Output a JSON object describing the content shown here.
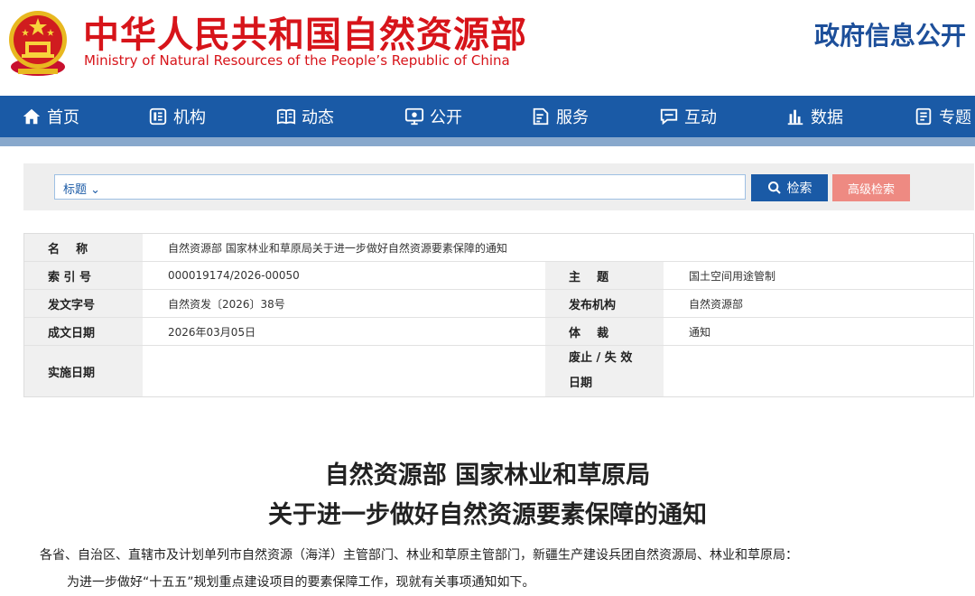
{
  "header": {
    "title_cn": "中华人民共和国自然资源部",
    "title_en": "Ministry of Natural Resources of the People’s Republic of China",
    "gov_open": "政府信息公开"
  },
  "nav": {
    "items": [
      {
        "label": "首页",
        "icon": "home-icon"
      },
      {
        "label": "机构",
        "icon": "org-icon"
      },
      {
        "label": "动态",
        "icon": "book-icon"
      },
      {
        "label": "公开",
        "icon": "monitor-icon"
      },
      {
        "label": "服务",
        "icon": "document-edit-icon"
      },
      {
        "label": "互动",
        "icon": "chat-icon"
      },
      {
        "label": "数据",
        "icon": "bar-chart-icon"
      },
      {
        "label": "专题",
        "icon": "file-icon"
      }
    ]
  },
  "search": {
    "select_label": "标题",
    "placeholder": "",
    "search_label": "检索",
    "advanced_label": "高级检索"
  },
  "info": {
    "name_label": "名    称",
    "name_value": "自然资源部 国家林业和草原局关于进一步做好自然资源要素保障的通知",
    "index_label": "索 引 号",
    "index_value": "000019174/2026-00050",
    "topic_label": "主    题",
    "topic_value": "国土空间用途管制",
    "docno_label": "发文字号",
    "docno_value": "自然资发〔2026〕38号",
    "publisher_label": "发布机构",
    "publisher_value": "自然资源部",
    "date_label": "成文日期",
    "date_value": "2026年03月05日",
    "genre_label": "体    裁",
    "genre_value": "通知",
    "effective_label": "实施日期",
    "effective_value": "",
    "expire_label_1": "废止 / 失 效",
    "expire_label_2": "日期",
    "expire_value": ""
  },
  "document": {
    "title_line1": "自然资源部 国家林业和草原局",
    "title_line2": "关于进一步做好自然资源要素保障的通知",
    "para1": "各省、自治区、直辖市及计划单列市自然资源（海洋）主管部门、林业和草原主管部门，新疆生产建设兵团自然资源局、林业和草原局：",
    "para2": "为进一步做好“十五五”规划重点建设项目的要素保障工作，现就有关事项通知如下。"
  },
  "colors": {
    "brand_red": "#d7141a",
    "nav_blue": "#1a5aa6",
    "advanced_btn": "#ee8a82"
  }
}
